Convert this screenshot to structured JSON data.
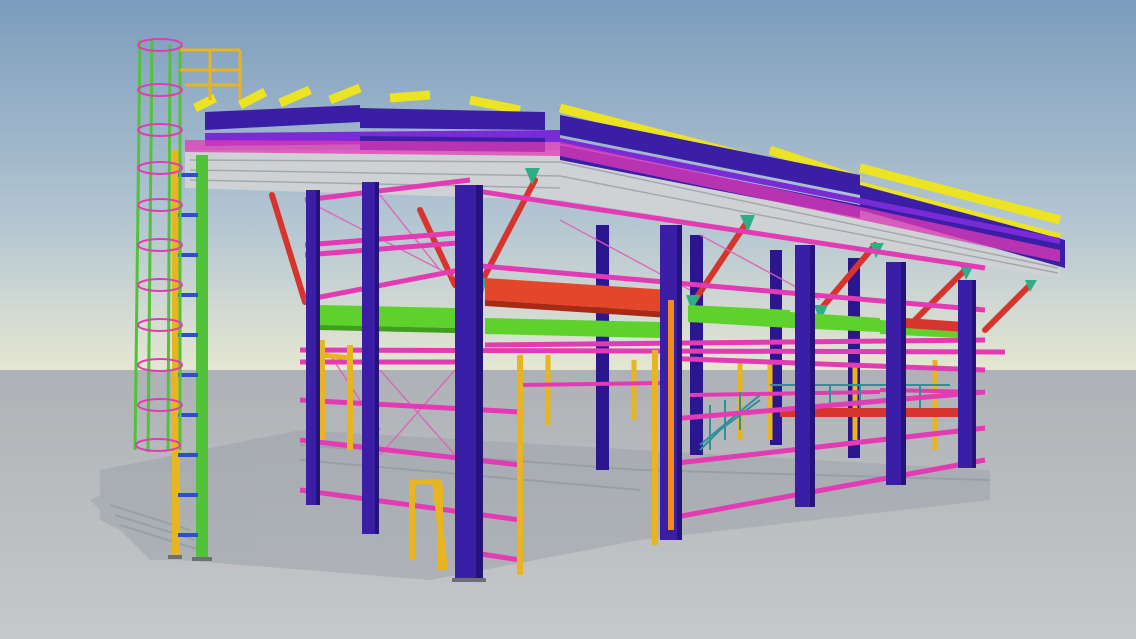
{
  "scene": {
    "subject": "steel-frame-structure",
    "colors": {
      "sky_top": "#7b9cbd",
      "sky_mid": "#b4c6d2",
      "horizon": "#e6e7d2",
      "ground_near": "#c3c5c7",
      "ground_far": "#aeb2b6",
      "shadow": "#9da3aa",
      "column": "#3a1fa6",
      "column_dark": "#26137a",
      "beam_magenta": "#e23bb4",
      "brace_red": "#d8342e",
      "beam_green": "#5fd12c",
      "rafter_yellow": "#ece323",
      "rail_yellow": "#e8b41f",
      "deck_grey": "#cfd2d5",
      "purlin_violet": "#7a2bd6",
      "ladder_green": "#52c23a",
      "gusset_teal": "#2fae86",
      "stair_teal": "#2f8f9a",
      "post_orange": "#f08a1a"
    }
  }
}
